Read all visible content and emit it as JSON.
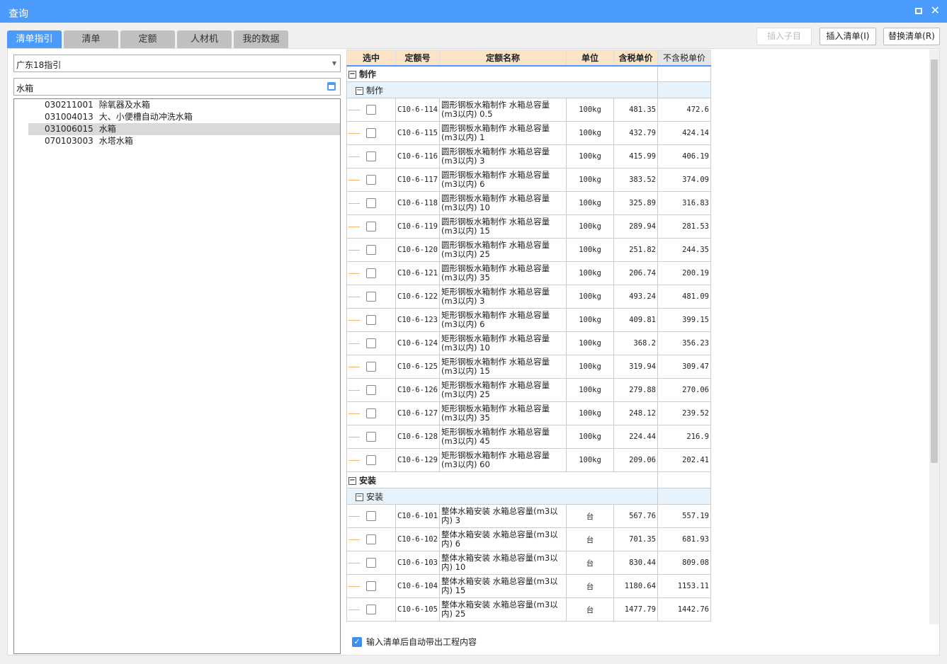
{
  "window": {
    "title": "查询",
    "accent": "#4a9bfb"
  },
  "tabs": [
    "清单指引",
    "清单",
    "定额",
    "人材机",
    "我的数据"
  ],
  "buttons": {
    "insert_sub": "插入子目",
    "insert_list": "插入清单(I)",
    "replace_list": "替换清单(R)"
  },
  "left": {
    "guide_select": "广东18指引",
    "search_value": "水箱",
    "tree": [
      {
        "code": "030211001",
        "name": "除氧器及水箱"
      },
      {
        "code": "031004013",
        "name": "大、小便槽自动冲洗水箱"
      },
      {
        "code": "031006015",
        "name": "水箱",
        "selected": true
      },
      {
        "code": "070103003",
        "name": "水塔水箱"
      }
    ]
  },
  "grid": {
    "headers": [
      "选中",
      "定额号",
      "定额名称",
      "单位",
      "含税单价",
      "不含税单价"
    ],
    "groups": [
      {
        "name": "制作",
        "sub": "制作",
        "rows": [
          [
            "C10-6-114",
            "圆形钢板水箱制作 水箱总容量(m3以内) 0.5",
            "100kg",
            "481.35",
            "472.6"
          ],
          [
            "C10-6-115",
            "圆形钢板水箱制作 水箱总容量(m3以内) 1",
            "100kg",
            "432.79",
            "424.14"
          ],
          [
            "C10-6-116",
            "圆形钢板水箱制作 水箱总容量(m3以内) 3",
            "100kg",
            "415.99",
            "406.19"
          ],
          [
            "C10-6-117",
            "圆形钢板水箱制作 水箱总容量(m3以内) 6",
            "100kg",
            "383.52",
            "374.09"
          ],
          [
            "C10-6-118",
            "圆形钢板水箱制作 水箱总容量(m3以内) 10",
            "100kg",
            "325.89",
            "316.83"
          ],
          [
            "C10-6-119",
            "圆形钢板水箱制作 水箱总容量(m3以内) 15",
            "100kg",
            "289.94",
            "281.53"
          ],
          [
            "C10-6-120",
            "圆形钢板水箱制作 水箱总容量(m3以内) 25",
            "100kg",
            "251.82",
            "244.35"
          ],
          [
            "C10-6-121",
            "圆形钢板水箱制作 水箱总容量(m3以内) 35",
            "100kg",
            "206.74",
            "200.19"
          ],
          [
            "C10-6-122",
            "矩形钢板水箱制作 水箱总容量(m3以内) 3",
            "100kg",
            "493.24",
            "481.09"
          ],
          [
            "C10-6-123",
            "矩形钢板水箱制作 水箱总容量(m3以内) 6",
            "100kg",
            "409.81",
            "399.15"
          ],
          [
            "C10-6-124",
            "矩形钢板水箱制作 水箱总容量(m3以内) 10",
            "100kg",
            "368.2",
            "356.23"
          ],
          [
            "C10-6-125",
            "矩形钢板水箱制作 水箱总容量(m3以内) 15",
            "100kg",
            "319.94",
            "309.47"
          ],
          [
            "C10-6-126",
            "矩形钢板水箱制作 水箱总容量(m3以内) 25",
            "100kg",
            "279.88",
            "270.06"
          ],
          [
            "C10-6-127",
            "矩形钢板水箱制作 水箱总容量(m3以内) 35",
            "100kg",
            "248.12",
            "239.52"
          ],
          [
            "C10-6-128",
            "矩形钢板水箱制作 水箱总容量(m3以内) 45",
            "100kg",
            "224.44",
            "216.9"
          ],
          [
            "C10-6-129",
            "矩形钢板水箱制作 水箱总容量(m3以内) 60",
            "100kg",
            "209.06",
            "202.41"
          ]
        ]
      },
      {
        "name": "安装",
        "sub": "安装",
        "rows": [
          [
            "C10-6-101",
            "整体水箱安装 水箱总容量(m3以内) 3",
            "台",
            "567.76",
            "557.19"
          ],
          [
            "C10-6-102",
            "整体水箱安装 水箱总容量(m3以内) 6",
            "台",
            "701.35",
            "681.93"
          ],
          [
            "C10-6-103",
            "整体水箱安装 水箱总容量(m3以内) 10",
            "台",
            "830.44",
            "809.08"
          ],
          [
            "C10-6-104",
            "整体水箱安装 水箱总容量(m3以内) 15",
            "台",
            "1180.64",
            "1153.11"
          ],
          [
            "C10-6-105",
            "整体水箱安装 水箱总容量(m3以内) 25",
            "台",
            "1477.79",
            "1442.76"
          ]
        ]
      }
    ]
  },
  "footer": {
    "auto_content_label": "输入清单后自动带出工程内容",
    "auto_content_checked": true
  }
}
